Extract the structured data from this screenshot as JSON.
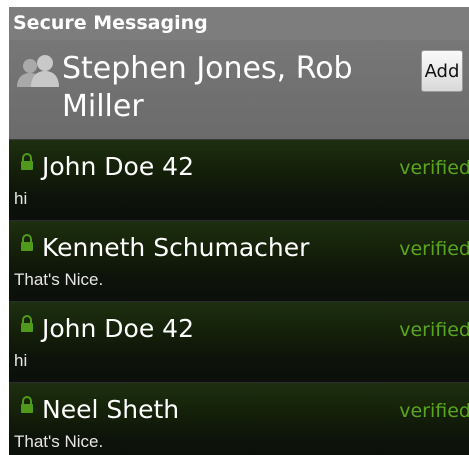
{
  "app": {
    "title": "Secure Messaging"
  },
  "header": {
    "title": "Stephen Jones, Rob Miller",
    "add_label": "Add",
    "icon": "group-contacts-icon"
  },
  "colors": {
    "verified": "#5aa51e",
    "lock": "#4f9a1a",
    "titlebar": "#7d7d7d"
  },
  "messages": [
    {
      "name": "John Doe 42",
      "status": "verified",
      "text": "hi",
      "icon": "lock-icon"
    },
    {
      "name": "Kenneth Schumacher",
      "status": "verified",
      "text": "That's Nice.",
      "icon": "lock-icon"
    },
    {
      "name": "John Doe 42",
      "status": "verified",
      "text": "hi",
      "icon": "lock-icon"
    },
    {
      "name": "Neel Sheth",
      "status": "verified",
      "text": "That's Nice.",
      "icon": "lock-icon"
    }
  ]
}
